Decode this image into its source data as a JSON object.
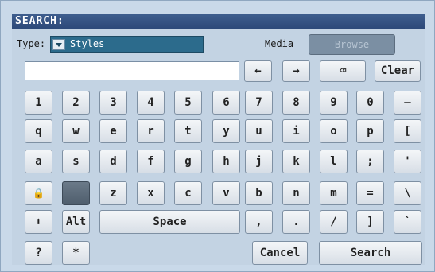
{
  "title": "SEARCH:",
  "type": {
    "label": "Type:",
    "value": "Styles"
  },
  "media": {
    "label": "Media",
    "browse_label": "Browse"
  },
  "search_field": {
    "value": ""
  },
  "nav_keys": {
    "left_glyph": "←",
    "right_glyph": "→",
    "backspace_glyph": "⌫",
    "clear_label": "Clear"
  },
  "rows": [
    [
      "1",
      "2",
      "3",
      "4",
      "5",
      "6",
      "7",
      "8",
      "9",
      "0",
      "–"
    ],
    [
      "q",
      "w",
      "e",
      "r",
      "t",
      "y",
      "u",
      "i",
      "o",
      "p",
      "["
    ],
    [
      "a",
      "s",
      "d",
      "f",
      "g",
      "h",
      "j",
      "k",
      "l",
      ";",
      "'"
    ],
    [
      "z",
      "x",
      "c",
      "v",
      "b",
      "n",
      "m",
      "=",
      "\\"
    ]
  ],
  "row4_prefix": {
    "lock_glyph": "🔒"
  },
  "bottom_row": {
    "shift_glyph": "⬆",
    "alt_label": "Alt",
    "space_label": "Space",
    "comma": ",",
    "period": ".",
    "slash": "/",
    "bracket_close": "]",
    "backtick": "`"
  },
  "last_row": {
    "question": "?",
    "asterisk": "*",
    "cancel_label": "Cancel",
    "search_label": "Search"
  },
  "colors": {
    "title_bar": "#2c4878",
    "dialog_bg": "#c3d3e3",
    "select_bg": "#2c6b8c",
    "browse_disabled": "#7b8fa3"
  }
}
